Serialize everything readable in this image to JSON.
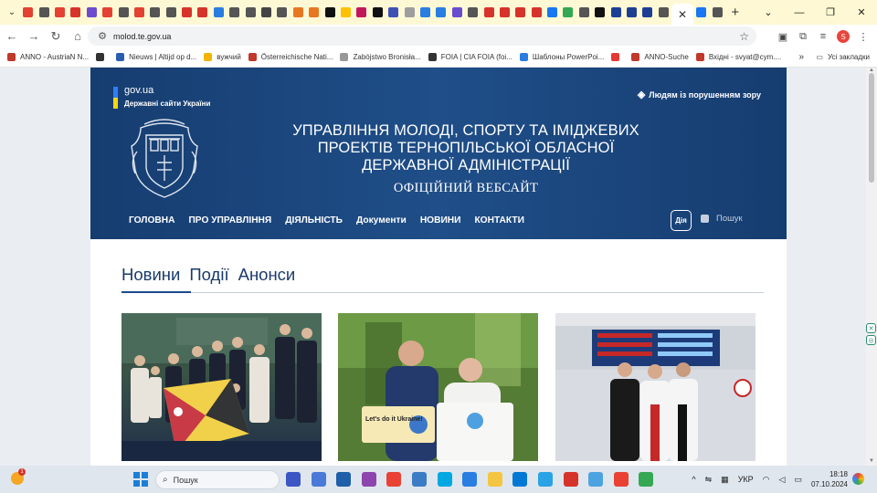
{
  "browser": {
    "active_tab_close": "✕",
    "new_tab": "+",
    "url": "molod.te.gov.ua",
    "profile_letter": "S",
    "tab_favicon_colors": [
      "#e34133",
      "#555555",
      "#e34133",
      "#d6332a",
      "#6a4ccf",
      "#e34133",
      "#555555",
      "#e34133",
      "#555555",
      "#555555",
      "#d6332a",
      "#d6332a",
      "#2a7de1",
      "#555555",
      "#555555",
      "#444444",
      "#555555",
      "#e87722",
      "#e87722",
      "#111111",
      "#ffc107",
      "#c2185b",
      "#111111",
      "#3f51b5",
      "#9e9e9e",
      "#2a7de1",
      "#2a7de1",
      "#6a4ccf",
      "#555555",
      "#d6332a",
      "#d6332a",
      "#d6332a",
      "#d6332a",
      "#1877f2",
      "#34a853",
      "#555555",
      "#111111",
      "#1c3f94",
      "#1c3f94",
      "#1c3f94",
      "#555555",
      "#1877f2",
      "#555555"
    ]
  },
  "bookmarks": [
    {
      "label": "ANNO - AustriaN N...",
      "color": "#c0392b"
    },
    {
      "label": "",
      "color": "#333333"
    },
    {
      "label": "Nieuws | Altijd op d...",
      "color": "#2a5db0"
    },
    {
      "label": "вужчий",
      "color": "#f4b400"
    },
    {
      "label": "Österreichische Nati...",
      "color": "#c0392b"
    },
    {
      "label": "Zabójstwo Bronisła...",
      "color": "#999999"
    },
    {
      "label": "FOIA | CIA FOIA (foi...",
      "color": "#333333"
    },
    {
      "label": "Шаблоны PowerPoi...",
      "color": "#2a7de1"
    },
    {
      "label": "",
      "color": "#e53935"
    },
    {
      "label": "ANNO-Suche",
      "color": "#c0392b"
    },
    {
      "label": "Вхідні - svyat@cym....",
      "color": "#c0392b"
    }
  ],
  "bookmarks_more": "»",
  "bookmarks_all": "Усі закладки",
  "site": {
    "gov_name": "gov.ua",
    "gov_sub": "Державні сайти України",
    "accessibility": "Людям із порушенням зору",
    "title_lines": [
      "УПРАВЛІННЯ МОЛОДІ, СПОРТУ ТА ІМІДЖЕВИХ",
      "ПРОЕКТІВ ТЕРНОПІЛЬСЬКОЇ ОБЛАСНОЇ",
      "ДЕРЖАВНОЇ АДМІНІСТРАЦІЇ"
    ],
    "subtitle": "ОФІЦІЙНИЙ ВЕБСАЙТ",
    "nav": [
      "ГОЛОВНА",
      "ПРО УПРАВЛІННЯ",
      "ДІЯЛЬНІСТЬ",
      "Документи",
      "НОВИНИ",
      "КОНТАКТИ"
    ],
    "diia": "Дія",
    "search": "Пошук",
    "news_tabs": [
      "Новини",
      "Події",
      "Анонси"
    ],
    "active_tab": "Новини",
    "photo_text": {
      "lets_do_it": "Let's do it Ukraine!"
    }
  },
  "taskbar": {
    "search_label": "Пошук",
    "weather_badge": "1",
    "lang": "УКР",
    "time": "18:18",
    "date": "07.10.2024",
    "app_colors": [
      "#3d56c4",
      "#4a79d8",
      "#1f5ea8",
      "#8e44ad",
      "#e94235",
      "#3b7cc4",
      "#00a8e1",
      "#2a7de1",
      "#f4c542",
      "#0078d4",
      "#2aa3e6",
      "#d6332a",
      "#4da3e0",
      "#e94235",
      "#34a853"
    ]
  }
}
